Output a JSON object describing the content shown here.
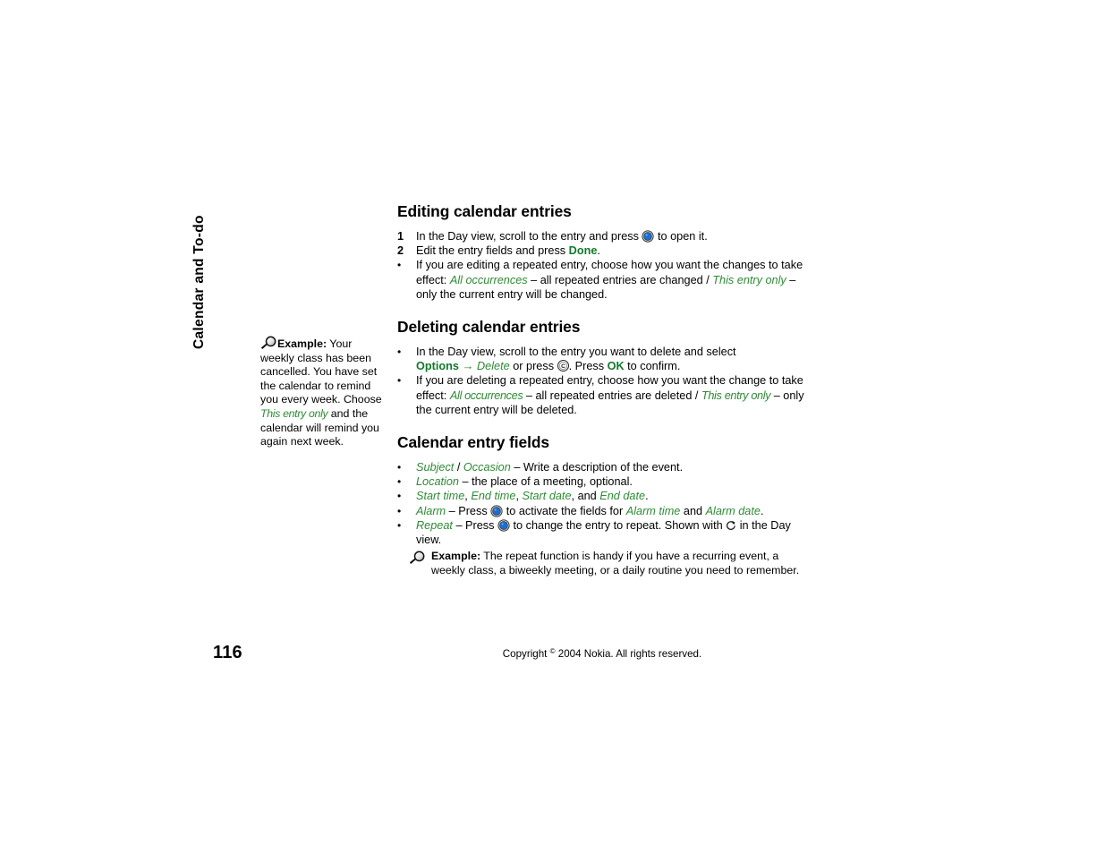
{
  "chapter": {
    "tab_label": "Calendar and To-do"
  },
  "sidebar_note": {
    "icon": "magnifier-icon",
    "label": "Example:",
    "text_before": " Your weekly class has been cancelled. You have set the calendar to remind you every week. Choose ",
    "emphasis": "This entry only",
    "text_after": " and the calendar will remind you again next week."
  },
  "sections": {
    "editing": {
      "heading": "Editing calendar entries",
      "steps": [
        {
          "marker": "1",
          "text_1": "In the Day view, scroll to the entry and press ",
          "icon": "nav-key-icon",
          "text_2": " to open it."
        },
        {
          "marker": "2",
          "text_1": "Edit the entry fields and press ",
          "bold_green": "Done",
          "text_2": "."
        },
        {
          "marker": "•",
          "text_1": "If you are editing a repeated entry, choose how you want the changes to take effect: ",
          "green_italic_1": "All occurrences",
          "text_2": " – all repeated entries are changed / ",
          "green_italic_2": "This entry only",
          "text_3": " – only the current entry will be changed."
        }
      ]
    },
    "deleting": {
      "heading": "Deleting calendar entries",
      "steps": [
        {
          "marker": "•",
          "text_1": "In the Day view, scroll to the entry you want to delete and select ",
          "bold_green": "Options",
          "arrow": "→",
          "green_italic_1": "Delete",
          "text_2": " or press ",
          "icon": "clear-key-icon",
          "text_3": ". Press ",
          "bold_green_2": "OK",
          "text_4": " to confirm."
        },
        {
          "marker": "•",
          "text_1": "If you are deleting a repeated entry, choose how you want the change to take effect: ",
          "green_italic_1": "All occurrences",
          "text_2": " – all repeated entries are deleted / ",
          "green_italic_2": "This entry only",
          "text_3": " – only the current entry will be deleted."
        }
      ]
    },
    "fields": {
      "heading": "Calendar entry fields",
      "bullets": [
        {
          "marker": "•",
          "green_italic_1": "Subject",
          "sep": " / ",
          "green_italic_2": "Occasion",
          "text": " – Write a description of the event."
        },
        {
          "marker": "•",
          "green_italic_1": "Location",
          "text": " – the place of a meeting, optional."
        },
        {
          "marker": "•",
          "green_italic_1": "Start time",
          "sep_1": ", ",
          "green_italic_2": "End time",
          "sep_2": ", ",
          "green_italic_3": "Start date",
          "sep_3": ", and ",
          "green_italic_4": "End date",
          "text": "."
        },
        {
          "marker": "•",
          "green_italic_1": "Alarm",
          "text_1": " – Press ",
          "icon": "nav-key-icon",
          "text_2": " to activate the fields for ",
          "green_italic_2": "Alarm time",
          "text_3": " and ",
          "green_italic_3": "Alarm date",
          "text_4": "."
        },
        {
          "marker": "•",
          "green_italic_1": "Repeat",
          "text_1": " – Press ",
          "icon": "nav-key-icon",
          "text_2": " to change the entry to repeat. Shown with ",
          "icon_2": "repeat-icon",
          "text_3": " in the Day view."
        }
      ],
      "example": {
        "icon": "magnifier-icon",
        "label": "Example:",
        "text": " The repeat function is handy if you have a recurring event, a weekly class, a biweekly meeting, or a daily routine you need to remember."
      }
    }
  },
  "footer": {
    "page_number": "116",
    "copyright_pre": "Copyright ",
    "copyright_symbol": "©",
    "copyright_post": " 2004 Nokia. All rights reserved."
  },
  "colors": {
    "green": "#2e8b35",
    "green_bold": "#117a2b",
    "nav_key_blue": "#1a6fd4",
    "text": "#000000",
    "background": "#ffffff"
  }
}
